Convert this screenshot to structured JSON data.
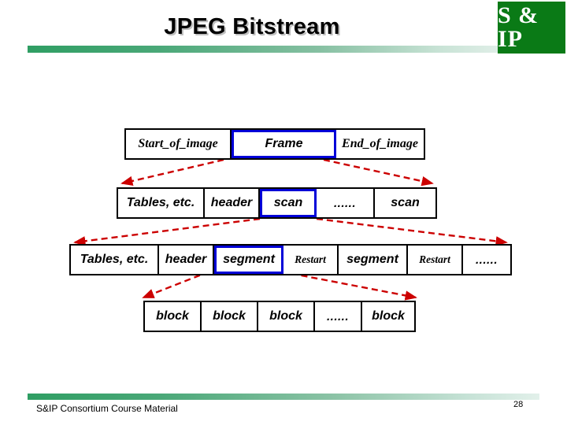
{
  "slide": {
    "title": "JPEG Bitstream",
    "logo_text": "S & IP",
    "accent_green": "#0a7a16",
    "rule_green": "#2f9e63",
    "highlight_blue": "#0000d8",
    "arrow_red": "#cc0000"
  },
  "footer": {
    "credit": "S&IP Consortium Course Material",
    "page_number": "28"
  },
  "diagram": {
    "rows": [
      {
        "name": "image-level",
        "cells": [
          {
            "label": "Start_of_image",
            "style": "serif-italic",
            "highlight": false
          },
          {
            "label": "Frame",
            "style": "sans-bold-italic",
            "highlight": true
          },
          {
            "label": "End_of_image",
            "style": "serif-italic",
            "highlight": false
          }
        ]
      },
      {
        "name": "frame-level",
        "cells": [
          {
            "label": "Tables, etc.",
            "style": "sans-bold-italic",
            "highlight": false
          },
          {
            "label": "header",
            "style": "sans-bold-italic",
            "highlight": false
          },
          {
            "label": "scan",
            "style": "sans-bold-italic",
            "highlight": true
          },
          {
            "label": "......",
            "style": "dots",
            "highlight": false
          },
          {
            "label": "scan",
            "style": "sans-bold-italic",
            "highlight": false
          }
        ]
      },
      {
        "name": "scan-level",
        "cells": [
          {
            "label": "Tables, etc.",
            "style": "sans-bold-italic",
            "highlight": false
          },
          {
            "label": "header",
            "style": "sans-bold-italic",
            "highlight": false
          },
          {
            "label": "segment",
            "style": "sans-bold-italic",
            "highlight": true
          },
          {
            "label": "Restart",
            "style": "serif-small",
            "highlight": false
          },
          {
            "label": "segment",
            "style": "sans-bold-italic",
            "highlight": false
          },
          {
            "label": "Restart",
            "style": "serif-small",
            "highlight": false
          },
          {
            "label": "......",
            "style": "dots",
            "highlight": false
          }
        ]
      },
      {
        "name": "segment-level",
        "cells": [
          {
            "label": "block",
            "style": "sans-bold-italic",
            "highlight": false
          },
          {
            "label": "block",
            "style": "sans-bold-italic",
            "highlight": false
          },
          {
            "label": "block",
            "style": "sans-bold-italic",
            "highlight": false
          },
          {
            "label": "......",
            "style": "dots",
            "highlight": false
          },
          {
            "label": "block",
            "style": "sans-bold-italic",
            "highlight": false
          }
        ]
      }
    ]
  }
}
